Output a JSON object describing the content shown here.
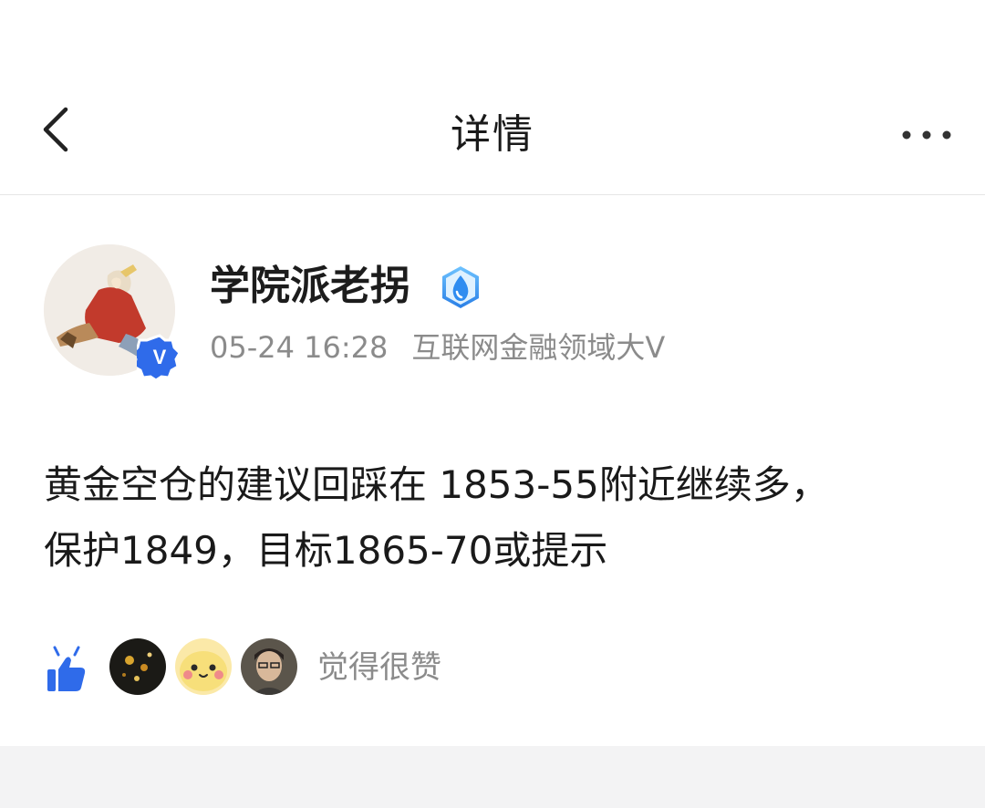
{
  "header": {
    "title": "详情",
    "back_icon": "chevron-left-icon",
    "more_icon": "more-horizontal-icon"
  },
  "post": {
    "author": {
      "name": "学院派老拐",
      "verified_icon": "verified-v-icon",
      "level_icon": "water-drop-badge-icon"
    },
    "timestamp": "05-24 16:28",
    "author_tag": "互联网金融领域大V",
    "content_line1": "黄金空仓的建议回踩在 1853-55附近继续多，",
    "content_line2": "保护1849，目标1865-70或提示"
  },
  "likes": {
    "icon": "thumbs-up-icon",
    "text": "觉得很赞"
  },
  "colors": {
    "accent_blue": "#2f6bea",
    "text_primary": "#1a1a1a",
    "text_secondary": "#8b8b8b",
    "divider": "#e6e6e6",
    "footer_bg": "#f3f3f4"
  }
}
